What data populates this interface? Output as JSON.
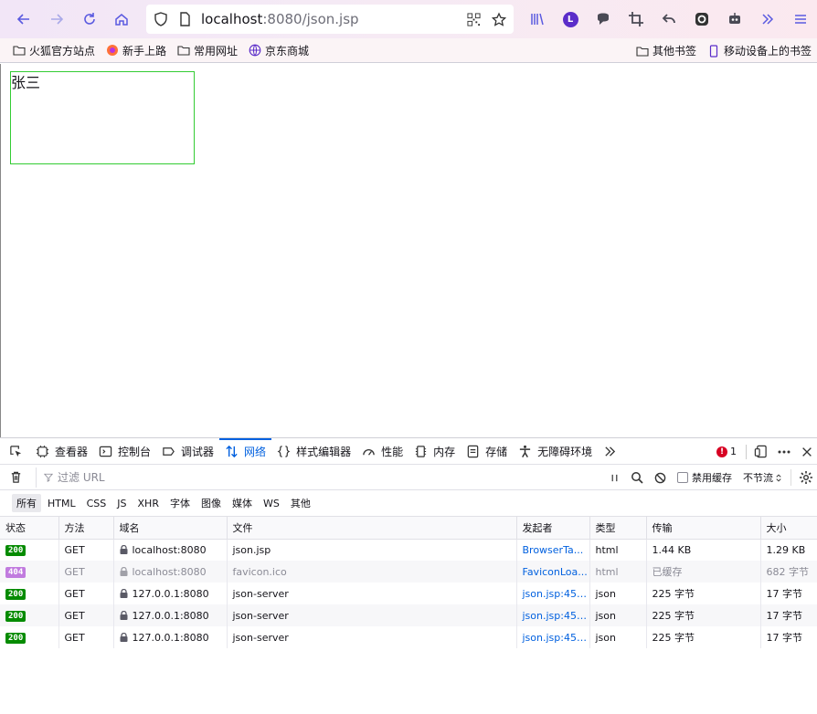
{
  "browser": {
    "url_host": "localhost",
    "url_rest": ":8080/json.jsp",
    "bookmarks": [
      {
        "label": "火狐官方站点",
        "icon": "folder-icon"
      },
      {
        "label": "新手上路",
        "icon": "firefox-icon"
      },
      {
        "label": "常用网址",
        "icon": "folder-icon"
      },
      {
        "label": "京东商城",
        "icon": "globe-icon"
      }
    ],
    "bookmarks_right": [
      {
        "label": "其他书签",
        "icon": "folder-icon"
      },
      {
        "label": "移动设备上的书签",
        "icon": "mobile-icon"
      }
    ],
    "account_initial": "L",
    "accent_color": "#5b2dc9"
  },
  "page": {
    "box_text": "张三",
    "box_border_color": "#33cc33"
  },
  "devtools": {
    "tabs": [
      {
        "label": "查看器",
        "icon": "inspector-icon"
      },
      {
        "label": "控制台",
        "icon": "console-icon"
      },
      {
        "label": "调试器",
        "icon": "debugger-icon"
      },
      {
        "label": "网络",
        "icon": "network-icon",
        "active": true
      },
      {
        "label": "样式编辑器",
        "icon": "style-editor-icon"
      },
      {
        "label": "性能",
        "icon": "performance-icon"
      },
      {
        "label": "内存",
        "icon": "memory-icon"
      },
      {
        "label": "存储",
        "icon": "storage-icon"
      },
      {
        "label": "无障碍环境",
        "icon": "accessibility-icon"
      }
    ],
    "error_count": "1",
    "filter_placeholder": "过滤 URL",
    "disable_cache_label": "禁用缓存",
    "throttle_label": "不节流",
    "types": [
      "所有",
      "HTML",
      "CSS",
      "JS",
      "XHR",
      "字体",
      "图像",
      "媒体",
      "WS",
      "其他"
    ],
    "columns": [
      "状态",
      "方法",
      "域名",
      "文件",
      "发起者",
      "类型",
      "传输",
      "大小"
    ],
    "rows": [
      {
        "status": "200",
        "method": "GET",
        "domain": "localhost:8080",
        "file": "json.jsp",
        "initiator": "BrowserTa...",
        "type": "html",
        "transfer": "1.44 KB",
        "size": "1.29 KB",
        "muted": false
      },
      {
        "status": "404",
        "method": "GET",
        "domain": "localhost:8080",
        "file": "favicon.ico",
        "initiator": "FaviconLoa...",
        "type": "html",
        "transfer": "已缓存",
        "size": "682 字节",
        "muted": true
      },
      {
        "status": "200",
        "method": "GET",
        "domain": "127.0.0.1:8080",
        "file": "json-server",
        "initiator": "json.jsp:45 ...",
        "type": "json",
        "transfer": "225 字节",
        "size": "17 字节",
        "muted": false
      },
      {
        "status": "200",
        "method": "GET",
        "domain": "127.0.0.1:8080",
        "file": "json-server",
        "initiator": "json.jsp:45 ...",
        "type": "json",
        "transfer": "225 字节",
        "size": "17 字节",
        "muted": false
      },
      {
        "status": "200",
        "method": "GET",
        "domain": "127.0.0.1:8080",
        "file": "json-server",
        "initiator": "json.jsp:45 ...",
        "type": "json",
        "transfer": "225 字节",
        "size": "17 字节",
        "muted": false
      }
    ]
  }
}
